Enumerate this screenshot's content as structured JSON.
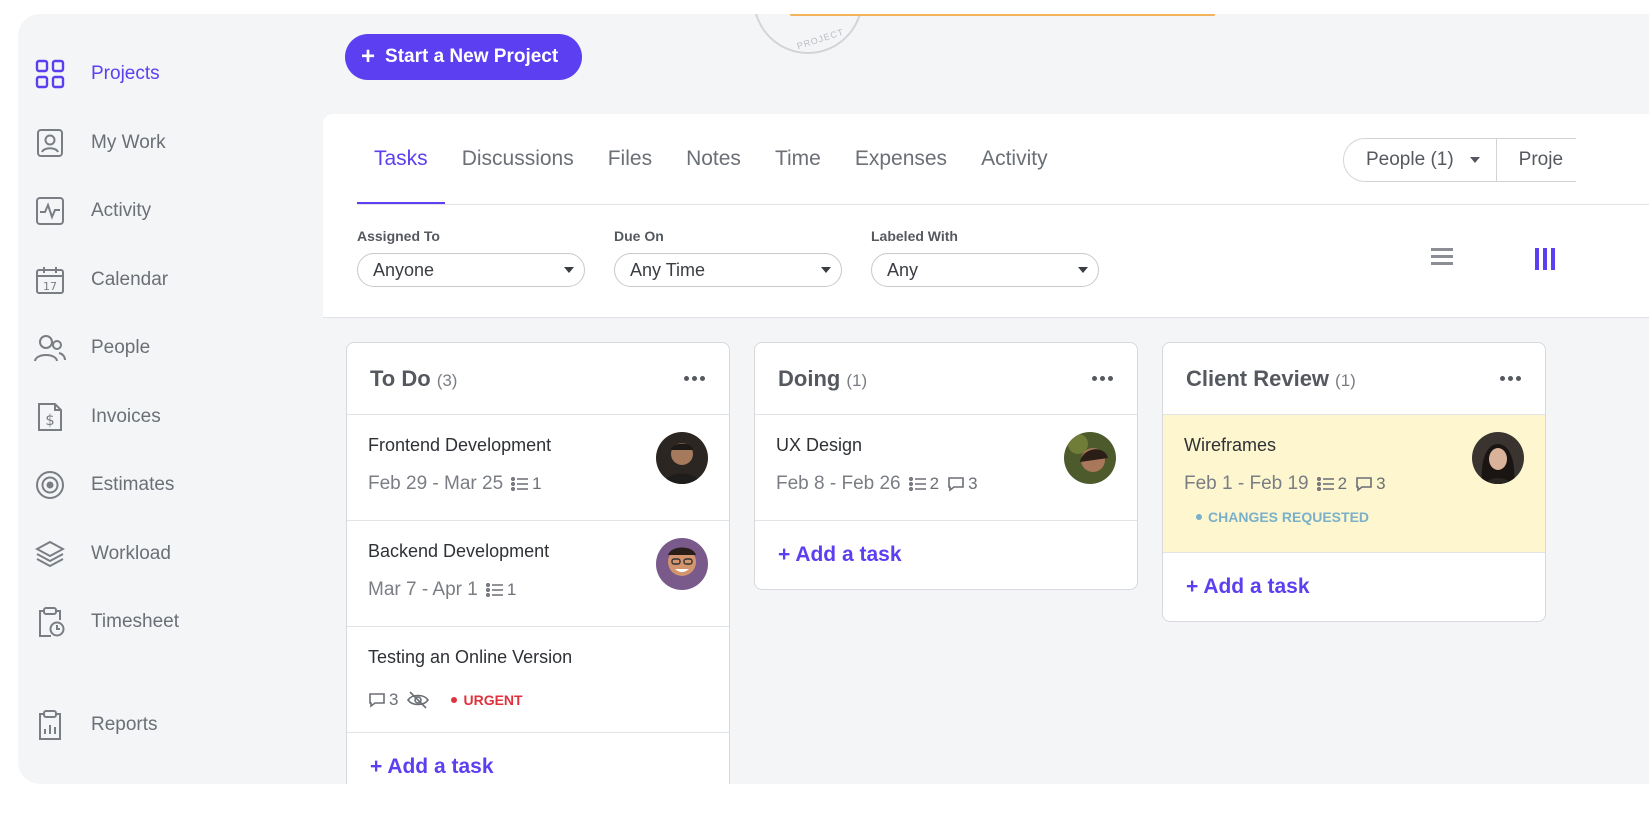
{
  "sidebar": {
    "items": [
      {
        "label": "Projects",
        "icon": "grid-icon",
        "active": true
      },
      {
        "label": "My Work",
        "icon": "user-square-icon"
      },
      {
        "label": "Activity",
        "icon": "pulse-icon"
      },
      {
        "label": "Calendar",
        "icon": "calendar-icon",
        "icon_text": "17"
      },
      {
        "label": "People",
        "icon": "people-icon"
      },
      {
        "label": "Invoices",
        "icon": "invoice-dollar-icon",
        "icon_text": "$"
      },
      {
        "label": "Estimates",
        "icon": "target-icon"
      },
      {
        "label": "Workload",
        "icon": "layers-icon"
      },
      {
        "label": "Timesheet",
        "icon": "clipboard-clock-icon"
      },
      {
        "label": "Reports",
        "icon": "clipboard-chart-icon"
      }
    ]
  },
  "top": {
    "new_project_label": "Start a New Project",
    "stamp_text": "PROJECT"
  },
  "tabs": [
    "Tasks",
    "Discussions",
    "Files",
    "Notes",
    "Time",
    "Expenses",
    "Activity"
  ],
  "active_tab": "Tasks",
  "segment": {
    "people": "People (1)",
    "projects": "Proje"
  },
  "filters": [
    {
      "label": "Assigned To",
      "value": "Anyone"
    },
    {
      "label": "Due On",
      "value": "Any Time"
    },
    {
      "label": "Labeled With",
      "value": "Any"
    }
  ],
  "columns": [
    {
      "title": "To Do",
      "count": "(3)",
      "cards": [
        {
          "title": "Frontend Development",
          "dates": "Feb 29 - Mar 25",
          "subtasks": "1"
        },
        {
          "title": "Backend Development",
          "dates": "Mar 7 - Apr 1",
          "subtasks": "1"
        },
        {
          "title": "Testing an Online Version",
          "comments": "3",
          "badge": "URGENT"
        }
      ],
      "add_label": "+ Add a task"
    },
    {
      "title": "Doing",
      "count": "(1)",
      "cards": [
        {
          "title": "UX Design",
          "dates": "Feb 8 - Feb 26",
          "subtasks": "2",
          "comments": "3"
        }
      ],
      "add_label": "+ Add a task"
    },
    {
      "title": "Client Review",
      "count": "(1)",
      "cards": [
        {
          "title": "Wireframes",
          "dates": "Feb 1 - Feb 19",
          "subtasks": "2",
          "comments": "3",
          "status": "CHANGES REQUESTED"
        }
      ],
      "add_label": "+ Add a task"
    }
  ],
  "colors": {
    "accent": "#5b3ff0",
    "urgent": "#e0323c",
    "status": "#7ab0c9",
    "highlight": "#fdf6cf"
  }
}
